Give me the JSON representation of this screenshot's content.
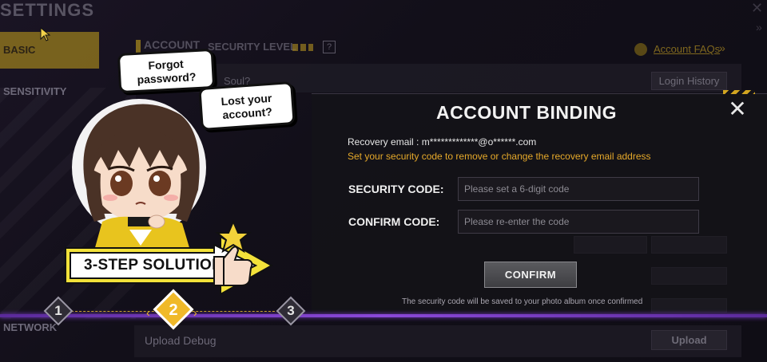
{
  "background": {
    "title": "SETTINGS",
    "sidebar": [
      "BASIC",
      "SENSITIVITY",
      "NETWORK"
    ],
    "header": {
      "account": "ACCOUNT",
      "security_level": "SECURITY LEVEL",
      "faq": "Account FAQs"
    },
    "rows": {
      "soul_label": "Soul?",
      "login_history": "Login History",
      "upload_debug": "Upload Debug",
      "upload_button": "Upload"
    }
  },
  "modal": {
    "title": "ACCOUNT BINDING",
    "recovery_email_label": "Recovery email",
    "recovery_email_value": "m*************@o******.com",
    "recovery_note": "Set your security code to remove or change the recovery email address",
    "security_code_label": "SECURITY CODE:",
    "security_code_placeholder": "Please set a 6-digit code",
    "confirm_code_label": "CONFIRM CODE:",
    "confirm_code_placeholder": "Please re-enter the code",
    "confirm_button": "CONFIRM",
    "footer_note": "The security code will be saved to your photo album once confirmed"
  },
  "tutorial": {
    "bubble_1": "Forgot password?",
    "bubble_2": "Lost your account?",
    "banner": "3-STEP SOLUTION",
    "steps": [
      "1",
      "2",
      "3"
    ]
  },
  "colors": {
    "accent": "#e6a92a",
    "active_step": "#f0b929",
    "purple_line": "#8a48d8"
  }
}
